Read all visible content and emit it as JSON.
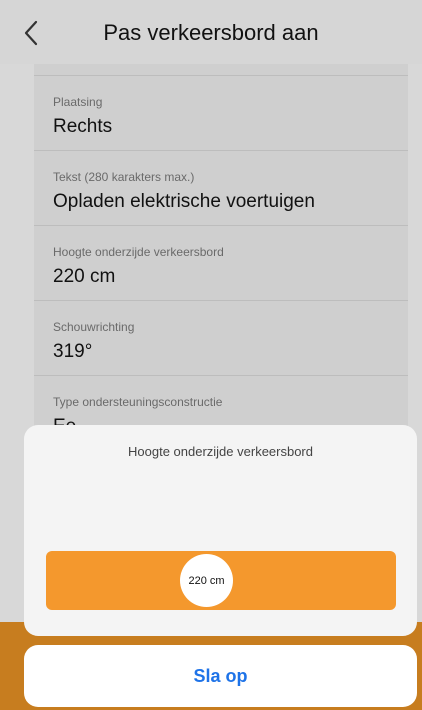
{
  "header": {
    "title": "Pas verkeersbord aan"
  },
  "list": {
    "rows": [
      {
        "label": "Plaatsing",
        "value": "Rechts"
      },
      {
        "label": "Tekst (280 karakters max.)",
        "value": "Opladen elektrische voertuigen"
      },
      {
        "label": "Hoogte onderzijde verkeersbord",
        "value": "220 cm"
      },
      {
        "label": "Schouwrichting",
        "value": "319°"
      },
      {
        "label": "Type ondersteuningsconstructie",
        "value": "Ee...."
      }
    ]
  },
  "sheet": {
    "title": "Hoogte onderzijde verkeersbord",
    "slider_value_label": "220 cm",
    "slider_position": 0.45
  },
  "actions": {
    "save_label": "Sla op"
  },
  "colors": {
    "accent_orange": "#f4982d",
    "link_blue": "#1e73e8"
  }
}
